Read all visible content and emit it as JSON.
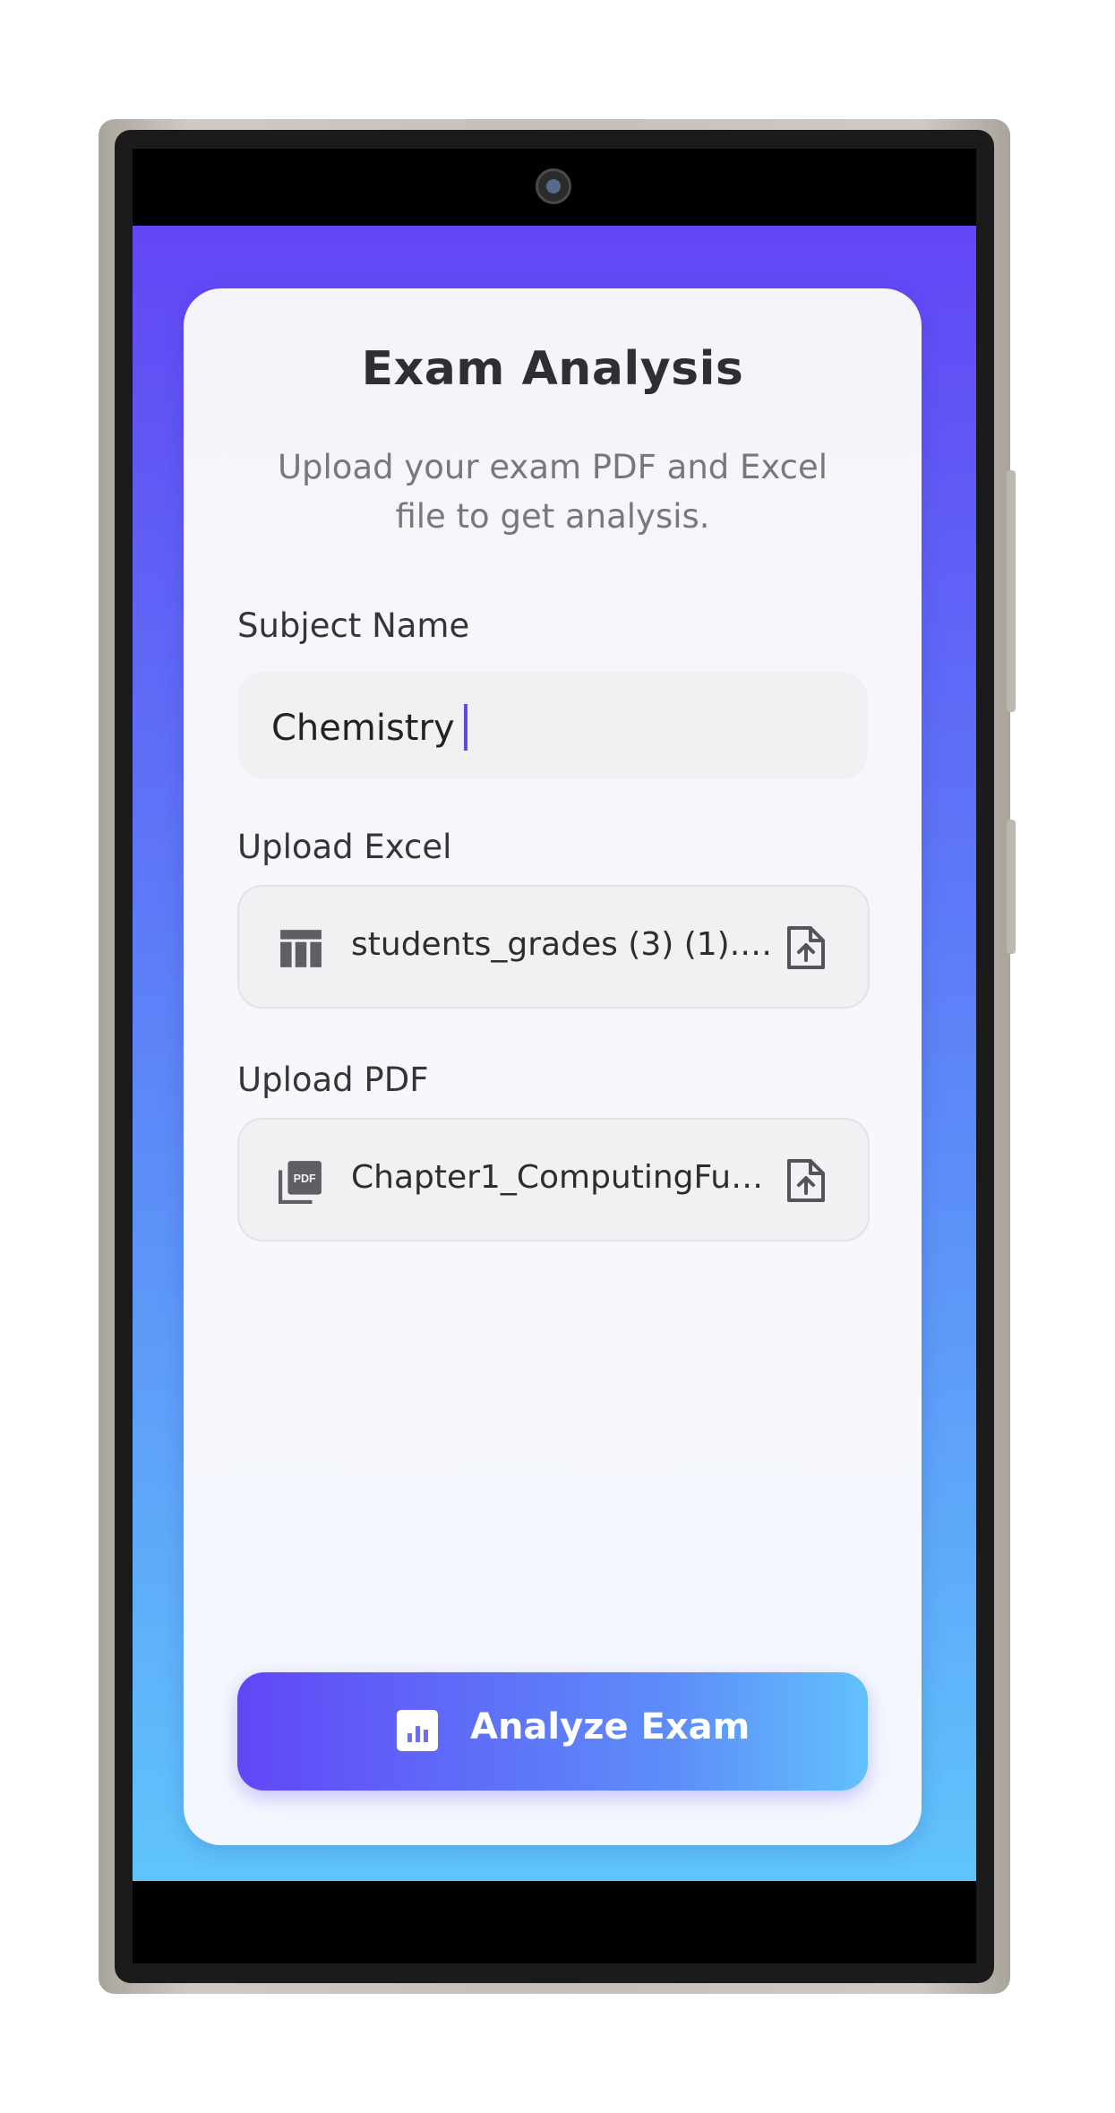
{
  "app": {
    "title": "Exam Analysis",
    "subtitle": "Upload your exam PDF and Excel file to get analysis."
  },
  "subject": {
    "label": "Subject Name",
    "value": "Chemistry"
  },
  "excel": {
    "label": "Upload Excel",
    "file_name": "students_grades (3) (1).xlsx",
    "icon": "table-icon"
  },
  "pdf": {
    "label": "Upload PDF",
    "file_name": "Chapter1_ComputingFund...",
    "icon": "pdf-icon"
  },
  "analyze_button": {
    "label": "Analyze Exam",
    "icon": "bar-chart-icon"
  },
  "colors": {
    "gradient_top": "#6246f6",
    "gradient_bottom": "#60c4fb",
    "caret": "#5b4bd8"
  }
}
